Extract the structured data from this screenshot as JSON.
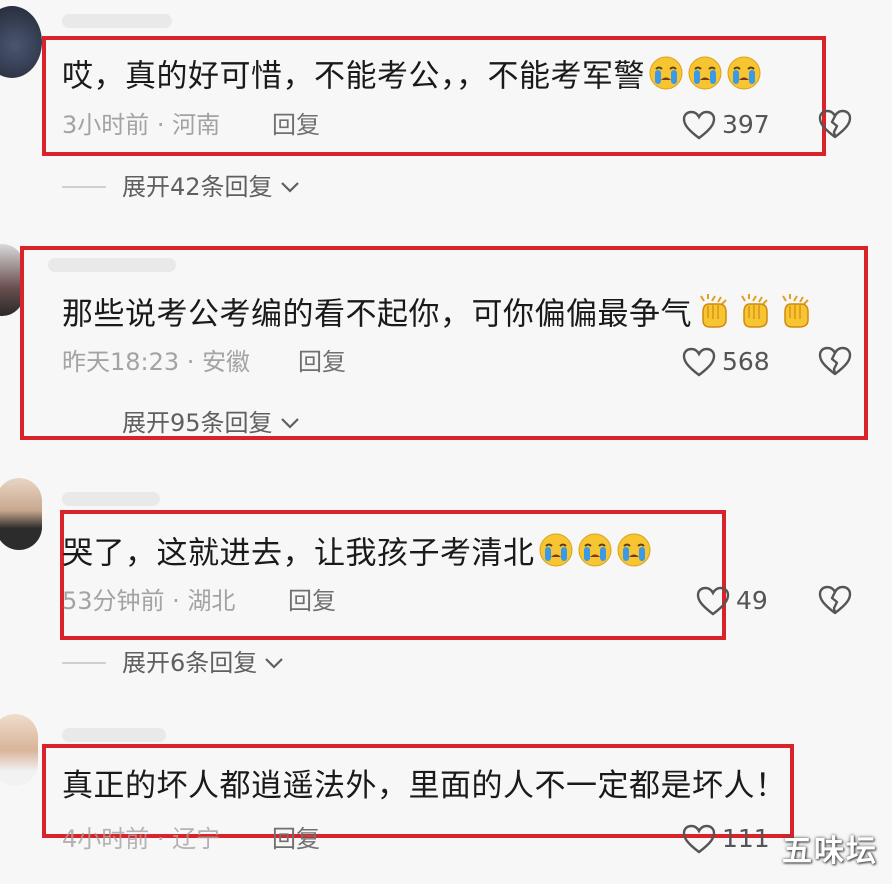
{
  "comments": [
    {
      "text": "哎，真的好可惜，不能考公，，不能考军警",
      "emoji_name": "crying-face-icon",
      "emoji_count": 3,
      "time": "3小时前",
      "location": "河南",
      "reply_label": "回复",
      "likes": "397",
      "expand": "展开42条回复"
    },
    {
      "text": "那些说考公考编的看不起你，可你偏偏最争气",
      "emoji_name": "applause-hands-icon",
      "emoji_count": 3,
      "time": "昨天18:23",
      "location": "安徽",
      "reply_label": "回复",
      "likes": "568",
      "expand": "展开95条回复"
    },
    {
      "text": "哭了，这就进去，让我孩子考清北",
      "emoji_name": "crying-face-icon",
      "emoji_count": 3,
      "time": "53分钟前",
      "location": "湖北",
      "reply_label": "回复",
      "likes": "49",
      "expand": "展开6条回复"
    },
    {
      "text": "真正的坏人都逍遥法外，里面的人不一定都是坏人！",
      "emoji_name": "",
      "emoji_count": 0,
      "time": "4小时前",
      "location": "辽宁",
      "reply_label": "回复",
      "likes": "111",
      "expand": ""
    }
  ],
  "meta_separator": " · ",
  "watermark": "五味坛",
  "colors": {
    "highlight_frame": "#d8232a",
    "meta_text": "#a3a3a3",
    "emoji_yellow": "#f7c531",
    "tear_blue": "#3a9ae6"
  }
}
